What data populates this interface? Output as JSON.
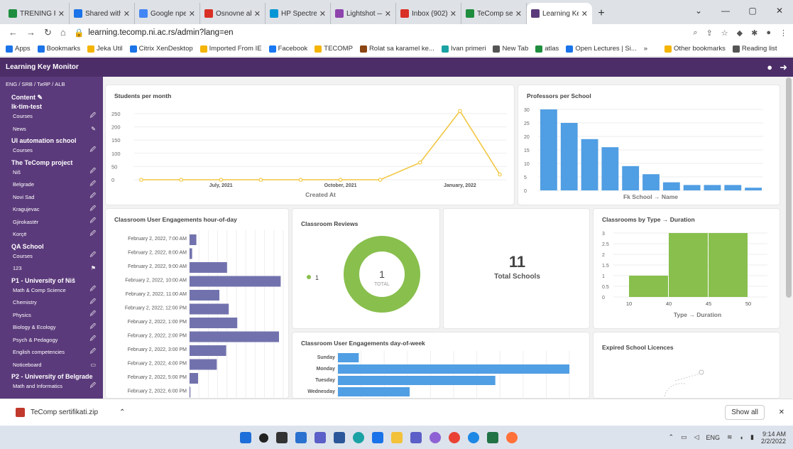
{
  "browser": {
    "tabs": [
      {
        "label": "TRENING FF -",
        "color": "#1e8e3e"
      },
      {
        "label": "Shared with m",
        "color": "#1a73e8"
      },
      {
        "label": "Google npeso",
        "color": "#4285f4"
      },
      {
        "label": "Osnovne akad",
        "color": "#d93025"
      },
      {
        "label": "HP Spectre HF",
        "color": "#0096d6"
      },
      {
        "label": "Lightshot — s",
        "color": "#8e44ad"
      },
      {
        "label": "Inbox (902) - j",
        "color": "#d93025"
      },
      {
        "label": "TeComp sertifi",
        "color": "#1e8e3e"
      },
      {
        "label": "Learning Key",
        "color": "#5b3a7b"
      }
    ],
    "url": "learning.tecomp.ni.ac.rs/admin?lang=en",
    "bookmarks": [
      "Apps",
      "Bookmarks",
      "Jeka Util",
      "Citrix XenDesktop",
      "Imported From IE",
      "Facebook",
      "TECOMP",
      "Rolat sa karamel ke...",
      "Ivan primeri",
      "New Tab",
      "atlas",
      "Open Lectures | Si...",
      "»",
      "Other bookmarks",
      "Reading list"
    ]
  },
  "app": {
    "title": "Learning Key Monitor",
    "lang": "ENG / SRB / ТиЯР / ALB",
    "sidebar": [
      {
        "t": "sec",
        "label": "Content ✎"
      },
      {
        "t": "sec",
        "label": "lk-tim-test"
      },
      {
        "t": "item",
        "label": "Courses",
        "icon": "🖉"
      },
      {
        "t": "item",
        "label": "News",
        "icon": "✎"
      },
      {
        "t": "sec",
        "label": "UI automation school"
      },
      {
        "t": "item",
        "label": "Courses",
        "icon": "🖉"
      },
      {
        "t": "sec",
        "label": "The TeComp project"
      },
      {
        "t": "item",
        "label": "Niš",
        "icon": "🖉"
      },
      {
        "t": "item",
        "label": "Belgrade",
        "icon": "🖉"
      },
      {
        "t": "item",
        "label": "Novi Sad",
        "icon": "🖉"
      },
      {
        "t": "item",
        "label": "Kragujevac",
        "icon": "🖉"
      },
      {
        "t": "item",
        "label": "Gjirokastër",
        "icon": "🖉"
      },
      {
        "t": "item",
        "label": "Korçë",
        "icon": "🖉"
      },
      {
        "t": "sec",
        "label": "QA School"
      },
      {
        "t": "item",
        "label": "Courses",
        "icon": "🖉"
      },
      {
        "t": "item",
        "label": "123",
        "icon": "⚑"
      },
      {
        "t": "sec",
        "label": "P1 - University of Niš"
      },
      {
        "t": "item",
        "label": "Math & Comp Science",
        "icon": "🖉"
      },
      {
        "t": "item",
        "label": "Chemistry",
        "icon": "🖉"
      },
      {
        "t": "item",
        "label": "Physics",
        "icon": "🖉"
      },
      {
        "t": "item",
        "label": "Biology & Ecology",
        "icon": "🖉"
      },
      {
        "t": "item",
        "label": "Psych & Pedagogy",
        "icon": "🖉"
      },
      {
        "t": "item",
        "label": "English competencies",
        "icon": "🖉"
      },
      {
        "t": "item",
        "label": "Noticeboard",
        "icon": "▭"
      },
      {
        "t": "sec",
        "label": "P2 - University of Belgrade"
      },
      {
        "t": "item",
        "label": "Math and Informatics",
        "icon": "🖉"
      }
    ],
    "cards": {
      "students": "Students per month",
      "professors": "Professors per School",
      "hour": "Classroom User Engagements hour-of-day",
      "reviews": "Classroom Reviews",
      "schools": "Total Schools",
      "duration": "Classrooms by Type → Duration",
      "dow": "Classroom User Engagements day-of-week",
      "expired": "Expired School Licences"
    },
    "reviews_value": "1",
    "reviews_total": "TOTAL",
    "reviews_legend": "1",
    "schools_value": "11"
  },
  "chart_data": [
    {
      "type": "line",
      "title": "Students per month",
      "xlabel": "Created At",
      "ylim": [
        0,
        250
      ],
      "yticks": [
        0,
        50,
        100,
        150,
        200,
        250
      ],
      "x": [
        "2021-05",
        "2021-06",
        "2021-07",
        "2021-08",
        "2021-09",
        "2021-10",
        "2021-11",
        "2021-12",
        "2022-01",
        "2022-02"
      ],
      "xticks": [
        "July, 2021",
        "October, 2021",
        "January, 2022"
      ],
      "values": [
        0,
        0,
        0,
        0,
        0,
        0,
        0,
        65,
        260,
        20
      ],
      "color": "#f2c744"
    },
    {
      "type": "bar",
      "title": "Professors per School",
      "xlabel": "Fk School → Name",
      "ylim": [
        0,
        30
      ],
      "yticks": [
        0,
        5,
        10,
        15,
        20,
        25,
        30
      ],
      "values": [
        30,
        25,
        19,
        16,
        9,
        6,
        3,
        2,
        2,
        2,
        1
      ],
      "color": "#509ee3"
    },
    {
      "type": "bar",
      "title": "Classroom User Engagements hour-of-day",
      "orientation": "horizontal",
      "categories": [
        "February 2, 2022, 7:00 AM",
        "February 2, 2022, 8:00 AM",
        "February 2, 2022, 9:00 AM",
        "February 2, 2022, 10:00 AM",
        "February 2, 2022, 11:00 AM",
        "February 2, 2022, 12:00 PM",
        "February 2, 2022, 1:00 PM",
        "February 2, 2022, 2:00 PM",
        "February 2, 2022, 3:00 PM",
        "February 2, 2022, 4:00 PM",
        "February 2, 2022, 5:00 PM",
        "February 2, 2022, 6:00 PM"
      ],
      "values": [
        8,
        3,
        44,
        107,
        35,
        46,
        56,
        105,
        43,
        32,
        10,
        1
      ],
      "xlim": [
        0,
        110
      ],
      "color": "#7172ad"
    },
    {
      "type": "pie",
      "title": "Classroom Reviews",
      "slices": [
        {
          "label": "1",
          "value": 1
        }
      ],
      "color": "#88bf4d"
    },
    {
      "type": "bar",
      "title": "Classrooms by Type → Duration",
      "xlabel": "Type → Duration",
      "ylim": [
        0,
        3
      ],
      "yticks": [
        "0",
        "0.5",
        "1",
        "1.5",
        "2",
        "2.5",
        "3"
      ],
      "categories": [
        "10",
        "40",
        "45",
        "50"
      ],
      "values": [
        1,
        3,
        3
      ],
      "color": "#88bf4d"
    },
    {
      "type": "bar",
      "title": "Classroom User Engagements day-of-week",
      "orientation": "horizontal",
      "categories": [
        "Sunday",
        "Monday",
        "Tuesday",
        "Wednesday"
      ],
      "values": [
        9,
        100,
        68,
        31
      ],
      "xlim": [
        0,
        100
      ],
      "color": "#509ee3"
    }
  ],
  "downloads": {
    "file": "TeComp sertifikati.zip",
    "show_all": "Show all"
  },
  "taskbar": {
    "lang": "ENG",
    "time": "9:14 AM",
    "date": "2/2/2022"
  }
}
